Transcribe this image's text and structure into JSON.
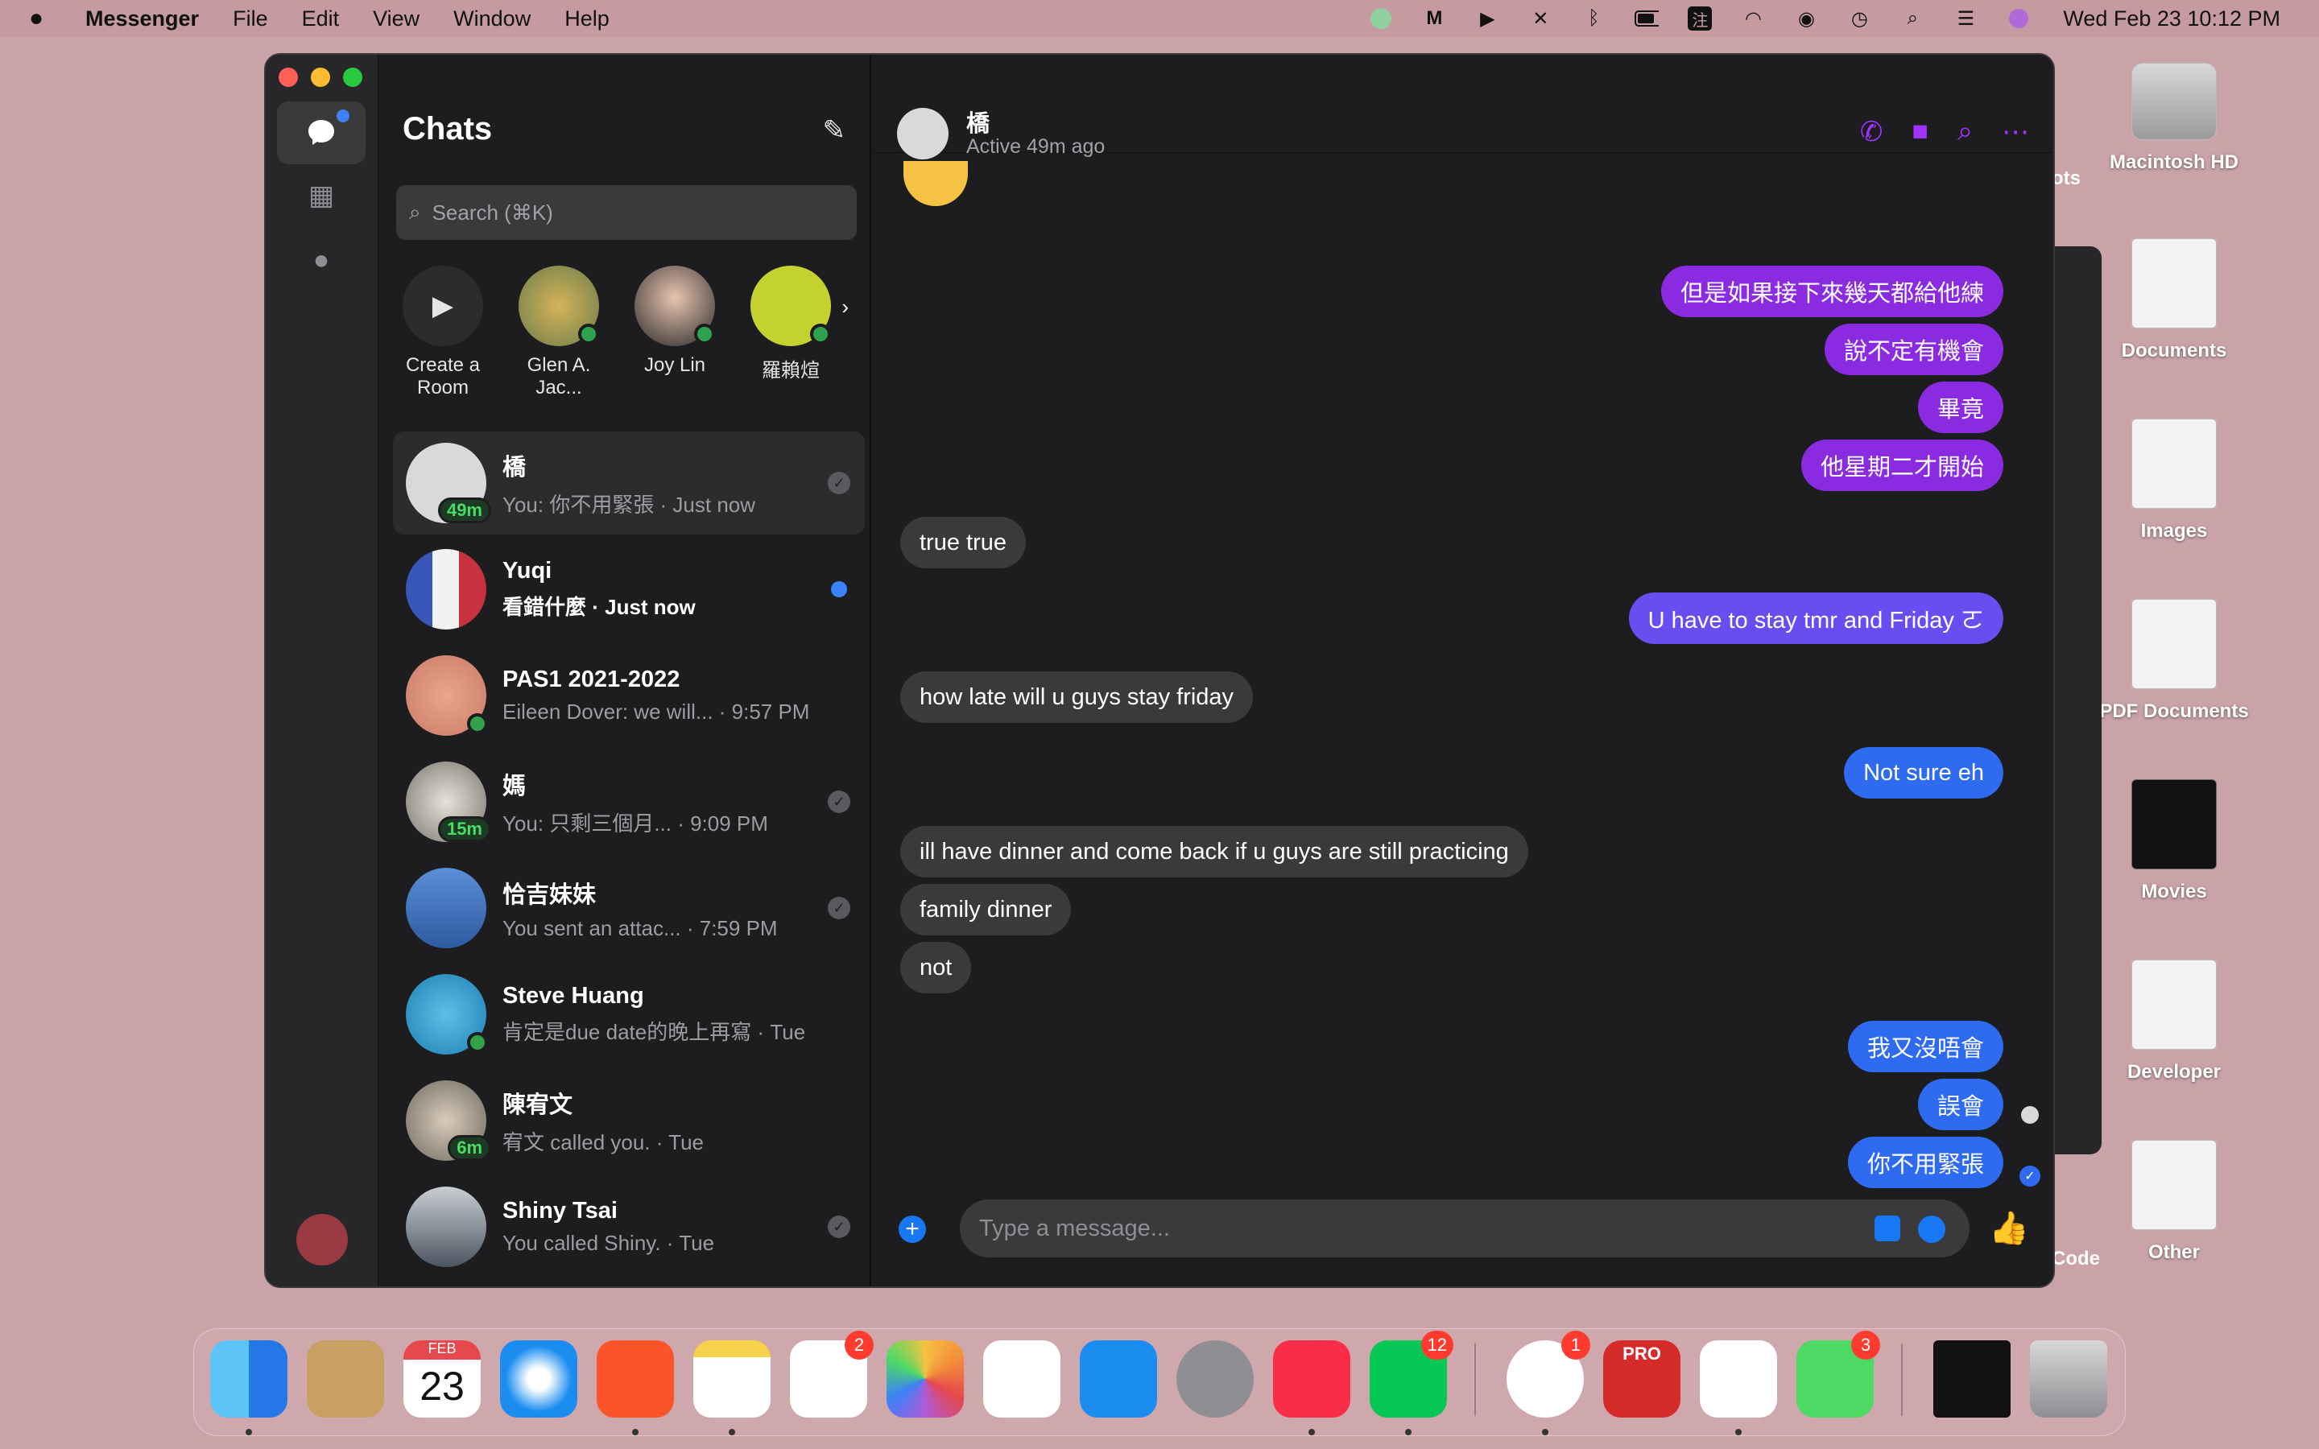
{
  "menubar": {
    "app_name": "Messenger",
    "menus": [
      "File",
      "Edit",
      "View",
      "Window",
      "Help"
    ],
    "clock": "Wed Feb 23  10:12 PM"
  },
  "sidebar": {
    "title": "Chats",
    "search_placeholder": "Search (⌘K)"
  },
  "stories": [
    {
      "label": "Create a Room",
      "icon": "video-plus-icon"
    },
    {
      "label": "Glen A. Jac...",
      "online": true
    },
    {
      "label": "Joy Lin",
      "online": true
    },
    {
      "label": "羅賴煊",
      "online": true
    }
  ],
  "chats": [
    {
      "name": "橋",
      "preview": "You: 你不用緊張 · Just now",
      "badge": "49m",
      "selected": true,
      "status": "read"
    },
    {
      "name": "Yuqi",
      "preview": "看錯什麼 · Just now",
      "unread": true,
      "status": "unread"
    },
    {
      "name": "PAS1 2021-2022",
      "preview": "Eileen Dover: we will...  · 9:57 PM",
      "online": true
    },
    {
      "name": "媽",
      "preview": "You: 只剩三個月...   · 9:09 PM",
      "badge": "15m",
      "status": "read"
    },
    {
      "name": "恰吉妹妹",
      "preview": "You sent an attac...  · 7:59 PM",
      "status": "read"
    },
    {
      "name": "Steve Huang",
      "preview": "肯定是due date的晚上再寫 · Tue",
      "online": true
    },
    {
      "name": "陳宥文",
      "preview": "宥文 called you. · Tue",
      "badge": "6m"
    },
    {
      "name": "Shiny Tsai",
      "preview": "You called Shiny. · Tue",
      "status": "read"
    }
  ],
  "conversation": {
    "name": "橋",
    "status": "Active 49m ago",
    "messages": [
      {
        "text": "但是如果接下來幾天都給他練",
        "dir": "out",
        "color": "purple"
      },
      {
        "text": "說不定有機會",
        "dir": "out",
        "color": "purple"
      },
      {
        "text": "畢竟",
        "dir": "out",
        "color": "purple"
      },
      {
        "text": "他星期二才開始",
        "dir": "out",
        "color": "purple"
      },
      {
        "text": "true true",
        "dir": "in"
      },
      {
        "text": "U have to stay tmr and Friday ㄛ",
        "dir": "out",
        "color": "indigo"
      },
      {
        "text": "how late will u guys stay friday",
        "dir": "in"
      },
      {
        "text": "Not sure eh",
        "dir": "out",
        "color": "blue"
      },
      {
        "text": "ill have dinner and come back if u guys are still practicing",
        "dir": "in"
      },
      {
        "text": "family dinner",
        "dir": "in"
      },
      {
        "text": "not",
        "dir": "in"
      },
      {
        "text": "我又沒唔會",
        "dir": "out",
        "color": "blue"
      },
      {
        "text": "誤會",
        "dir": "out",
        "color": "blue"
      },
      {
        "text": "你不用緊張",
        "dir": "out",
        "color": "blue"
      }
    ],
    "composer_placeholder": "Type a message..."
  },
  "desktop_icons": [
    "Macintosh HD",
    "Documents",
    "Images",
    "PDF Documents",
    "Movies",
    "Developer",
    "Other"
  ],
  "partial_labels": {
    "code": "Code",
    "ots": "ots"
  },
  "dock": {
    "calendar_month": "FEB",
    "calendar_day": "23",
    "badges": {
      "reminders": "2",
      "line": "12",
      "messenger": "1",
      "facetime": "3"
    },
    "pro_label": "PRO"
  },
  "colors": {
    "purple": "#8a2be2",
    "indigo": "#6a4df0",
    "blue": "#2f6bf0",
    "incoming": "#3a3a3c",
    "accent": "#a033ff",
    "online": "#31a24c"
  }
}
